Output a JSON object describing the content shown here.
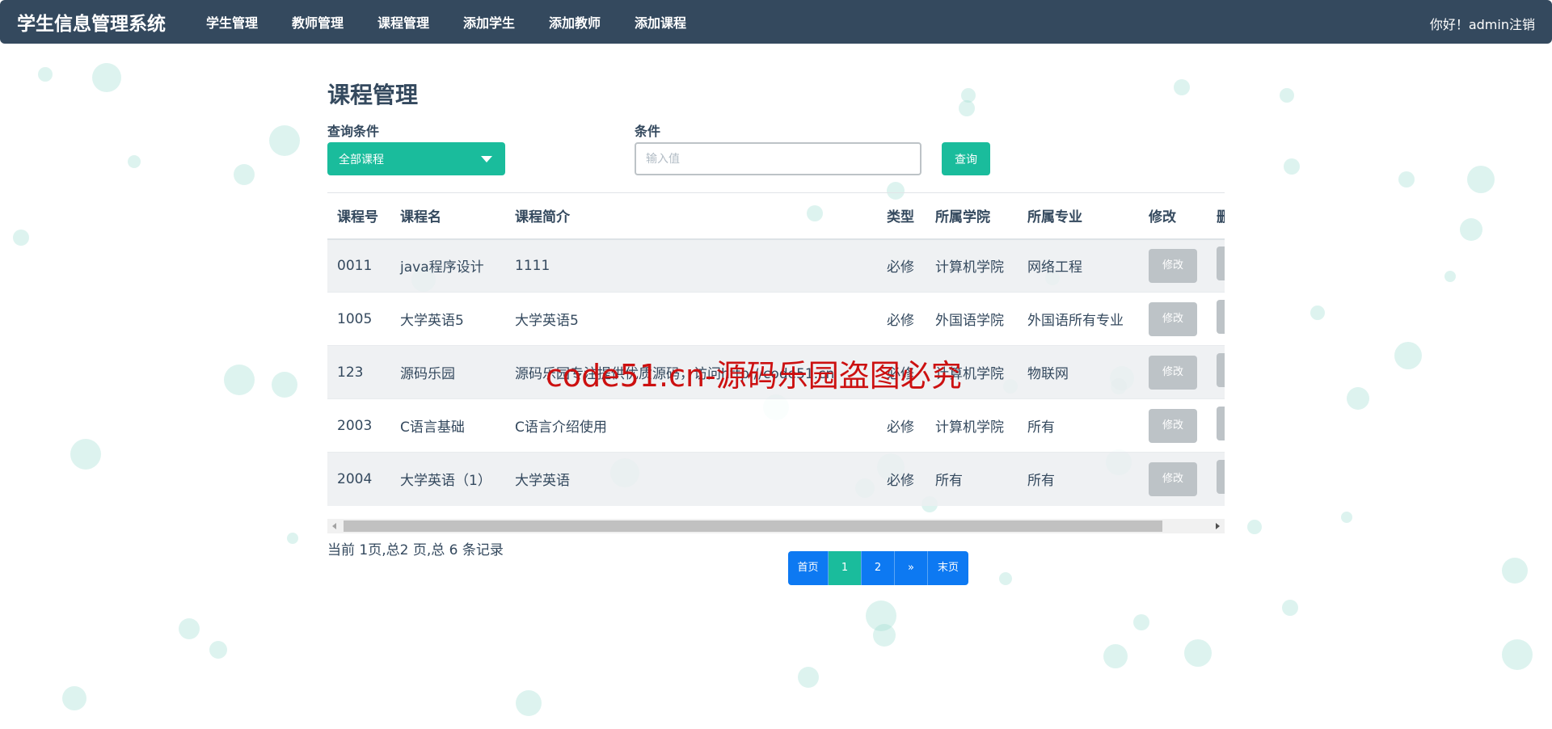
{
  "navbar": {
    "brand": "学生信息管理系统",
    "links": [
      "学生管理",
      "教师管理",
      "课程管理",
      "添加学生",
      "添加教师",
      "添加课程"
    ],
    "greeting": "你好！",
    "username": "admin",
    "logout": "注销"
  },
  "page": {
    "title": "课程管理",
    "query_label": "查询条件",
    "select_value": "全部课程",
    "condition_label": "条件",
    "input_placeholder": "输入值",
    "input_value": "",
    "query_button": "查询"
  },
  "table": {
    "headers": [
      "课程号",
      "课程名",
      "课程简介",
      "类型",
      "所属学院",
      "所属专业",
      "修改",
      "删"
    ],
    "rows": [
      {
        "id": "0011",
        "name": "java程序设计",
        "desc": "1111",
        "type": "必修",
        "college": "计算机学院",
        "major": "网络工程",
        "edit": "修改"
      },
      {
        "id": "1005",
        "name": "大学英语5",
        "desc": "大学英语5",
        "type": "必修",
        "college": "外国语学院",
        "major": "外国语所有专业",
        "edit": "修改"
      },
      {
        "id": "123",
        "name": "源码乐园",
        "desc": "源码乐园专注提供优质源码，访问http://code51.cn",
        "type": "必修",
        "college": "计算机学院",
        "major": "物联网",
        "edit": "修改"
      },
      {
        "id": "2003",
        "name": "C语言基础",
        "desc": "C语言介绍使用",
        "type": "必修",
        "college": "计算机学院",
        "major": "所有",
        "edit": "修改"
      },
      {
        "id": "2004",
        "name": "大学英语（1）",
        "desc": "大学英语",
        "type": "必修",
        "college": "所有",
        "major": "所有",
        "edit": "修改"
      }
    ]
  },
  "pagination": {
    "info": "当前 1页,总2 页,总 6 条记录",
    "first": "首页",
    "pages": [
      "1",
      "2"
    ],
    "current": "1",
    "next": "»",
    "last": "末页"
  },
  "watermark": "code51.cn-源码乐园盗图必究",
  "colors": {
    "navbar": "#34495e",
    "accent": "#1abc9c",
    "pager": "#0d79f2",
    "button_gray": "#bdc3c7",
    "watermark": "#cc1010"
  }
}
